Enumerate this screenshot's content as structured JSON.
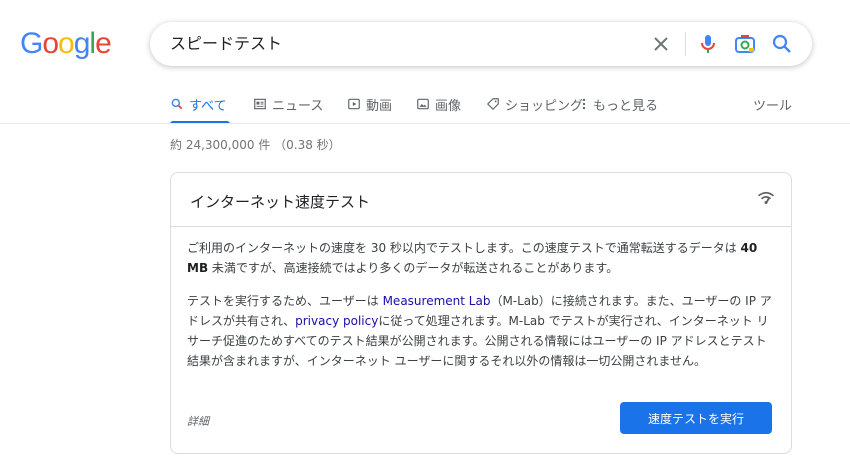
{
  "logo": {
    "text": "Google",
    "letters": [
      "G",
      "o",
      "o",
      "g",
      "l",
      "e"
    ],
    "colors": [
      "#4285f4",
      "#ea4335",
      "#fbbc05",
      "#4285f4",
      "#34a853",
      "#ea4335"
    ]
  },
  "search": {
    "query": "スピードテスト",
    "icons": [
      "close-icon",
      "mic-icon",
      "camera-icon",
      "search-icon"
    ]
  },
  "tabs": [
    {
      "label": "すべて",
      "icon": "search-icon",
      "active": true
    },
    {
      "label": "ニュース",
      "icon": "news-icon"
    },
    {
      "label": "動画",
      "icon": "video-icon"
    },
    {
      "label": "画像",
      "icon": "image-icon"
    },
    {
      "label": "ショッピング",
      "icon": "tag-icon"
    },
    {
      "label": "もっと見る",
      "icon": "more-icon"
    }
  ],
  "tools_label": "ツール",
  "result_stats": "約 24,300,000 件 （0.38 秒）",
  "card": {
    "title": "インターネット速度テスト",
    "para1": {
      "before": "ご利用のインターネットの速度を 30 秒以内でテストします。この速度テストで通常転送するデータは ",
      "bold": "40 MB",
      "after": " 未満ですが、高速接続ではより多くのデータが転送されることがあります。"
    },
    "para2": {
      "t1": "テストを実行するため、ユーザーは ",
      "link1": "Measurement Lab",
      "t2": "（M-Lab）に接続されます。また、ユーザーの IP アドレスが共有され、",
      "link2": "privacy policy",
      "t3": "に従って処理されます。M-Lab でテストが実行され、インターネット リサーチ促進のためすべてのテスト結果が公開されます。公開される情報にはユーザーの IP アドレスとテスト結果が含まれますが、インターネット ユーザーに関するそれ以外の情報は一切公開されません。"
    },
    "details_label": "詳細",
    "run_button": "速度テストを実行"
  },
  "colors": {
    "accent": "#1a73e8",
    "link": "#1a0dab"
  }
}
